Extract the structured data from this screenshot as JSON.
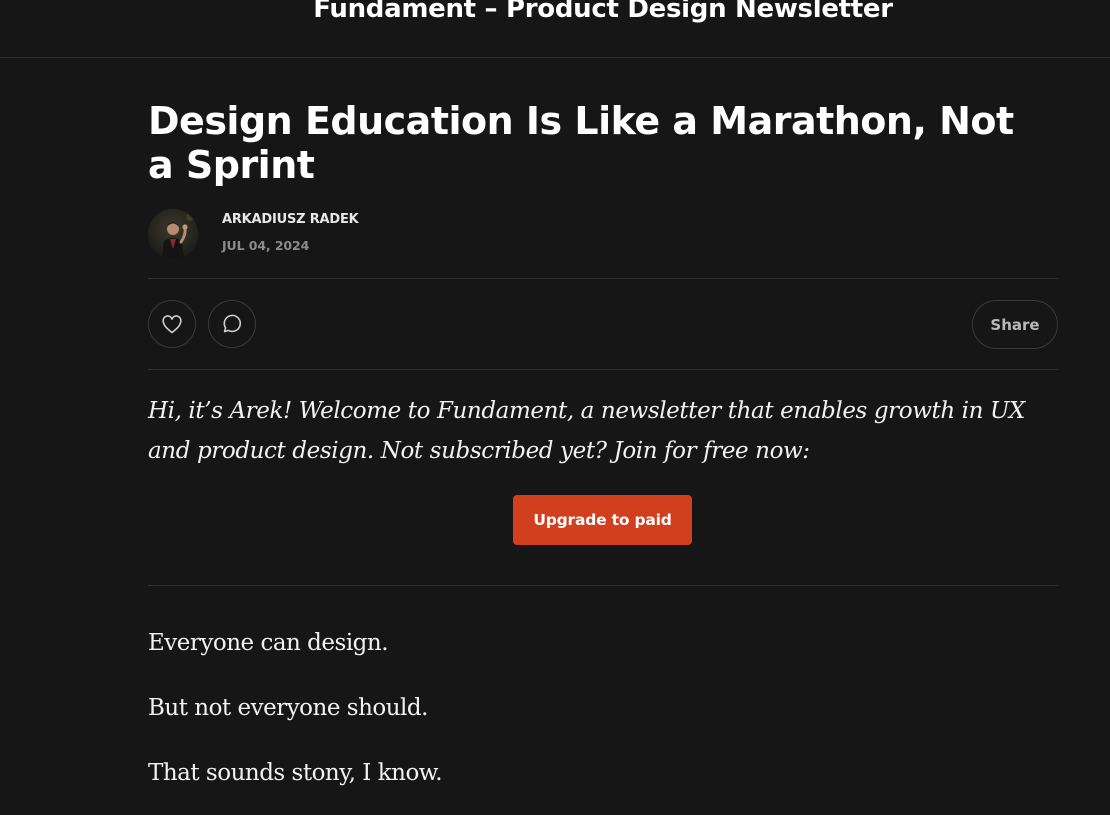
{
  "header": {
    "publication_title": "Fundament – Product Design Newsletter"
  },
  "post": {
    "title": "Design Education Is Like a Marathon, Not a Sprint",
    "author": "ARKADIUSZ RADEK",
    "date": "JUL 04, 2024"
  },
  "actions": {
    "like_icon": "heart-icon",
    "comment_icon": "comment-icon",
    "share_label": "Share"
  },
  "intro": {
    "text": "Hi, it’s Arek! Welcome to Fundament, a newsletter that enables growth in UX and product design. Not subscribed yet? Join for free now:",
    "cta_label": "Upgrade to paid"
  },
  "body": {
    "paragraphs": [
      "Everyone can design.",
      "But not everyone should.",
      "That sounds stony, I know."
    ]
  },
  "colors": {
    "background": "#161616",
    "accent": "#d13f1f",
    "divider": "#2e2e2e"
  }
}
